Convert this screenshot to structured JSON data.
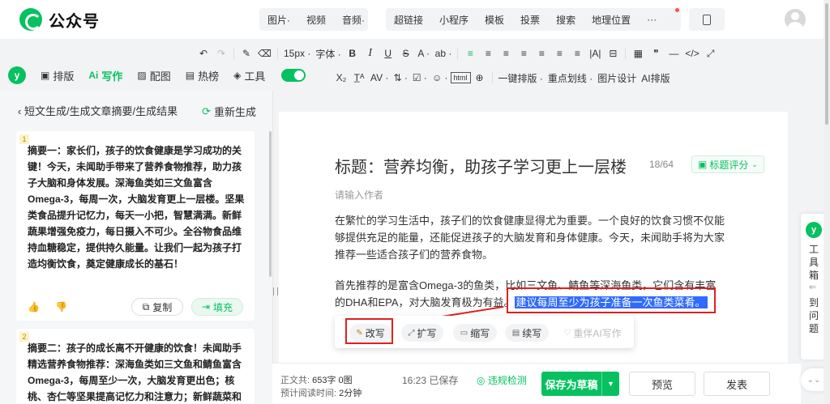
{
  "app": {
    "title": "公众号"
  },
  "insert_bar": {
    "group1": [
      "图片·",
      "视频",
      "音频·"
    ],
    "group2": [
      "超链接",
      "小程序",
      "模板",
      "投票",
      "搜索",
      "地理位置",
      "···"
    ]
  },
  "toolbar_row1": {
    "undo": "↶",
    "redo": "↷",
    "brush": "✎",
    "clear": "⌫",
    "font_size": "15px ·",
    "font_family": "字体 ·",
    "bold": "B",
    "italic": "I",
    "underline": "U",
    "strike": "S",
    "font_color": "A ·",
    "bg_color": "ab ·",
    "align_items": [
      "≡",
      "≡",
      "≡",
      "≡",
      "≡",
      "≡",
      "≡"
    ],
    "extra_items": [
      "|A|",
      "⊟",
      "▦",
      "❞",
      "—",
      "</>",
      "⤢"
    ]
  },
  "toolbar_row2": {
    "items": [
      "X₂",
      "T̲ᴬ",
      "AV ·",
      "⇅ ·",
      "☑ ·",
      "☺ ·",
      "html",
      "⊕"
    ],
    "ai_items": [
      "一键排版 ·",
      "重点划线 ·",
      "图片设计",
      "AI排版"
    ]
  },
  "tabs": {
    "logo": "y",
    "items": [
      {
        "icon": "▣",
        "label": "排版"
      },
      {
        "icon": "Ai",
        "label": "写作"
      },
      {
        "icon": "▨",
        "label": "配图"
      },
      {
        "icon": "▤",
        "label": "热榜"
      },
      {
        "icon": "◈",
        "label": "工具"
      }
    ]
  },
  "left_panel": {
    "breadcrumb": "‹ 短文生成/生成文章摘要/生成结果",
    "regenerate": "重新生成",
    "cards": [
      {
        "num": "1",
        "text": "摘要一：家长们，孩子的饮食健康是学习成功的关键！今天，未闻助手带来了营养食物推荐，助力孩子大脑和身体发展。深海鱼类如三文鱼富含Omega-3，每周一次，大脑发育更上一层楼。坚果类食品提升记忆力，每天一小把，智慧满满。新鲜蔬果增强免疫力，每日摄入不可少。全谷物食品维持血糖稳定，提供持久能量。让我们一起为孩子打造均衡饮食，奠定健康成长的基石！",
        "copy": "复制",
        "fill": "填充"
      },
      {
        "num": "2",
        "text": "摘要二：孩子的成长离不开健康的饮食！未闻助手精选营养食物推荐：深海鱼类如三文鱼和鲭鱼富含Omega-3，每周至少一次，大脑发育更出色；核桃、杏仁等坚果提高记忆力和注意力；新鲜蔬菜和水果"
      }
    ]
  },
  "editor": {
    "title": "标题：营养均衡，助孩子学习更上一层楼",
    "title_count": "18/64",
    "title_score": "标题评分",
    "author_placeholder": "请输入作者",
    "para1": "在繁忙的学习生活中，孩子们的饮食健康显得尤为重要。一个良好的饮食习惯不仅能够提供充足的能量，还能促进孩子的大脑发育和身体健康。今天，未闻助手将为大家推荐一些适合孩子们的营养食物。",
    "para2_line1": "首先推荐的是富含Omega-3的鱼类，比如三文鱼、鲭鱼等深海鱼类，它们含有丰富",
    "para2_line2": "的DHA和EPA，对大脑发育极为有益。",
    "para2_highlight": "建议每周至少为孩子准备一次鱼类菜肴。"
  },
  "ai_toolbar": {
    "rewrite": "改写",
    "expand": "扩写",
    "shorten": "缩写",
    "continue": "续写",
    "companion": "重伴AI写作"
  },
  "bottom_bar": {
    "word_count_label": "正文共:",
    "word_count_value": "653字 0图",
    "read_time_label": "预计阅读时间:",
    "read_time_value": "2分钟",
    "saved": "16:23 已保存",
    "check": "违规检测",
    "save_draft": "保存为草稿",
    "preview": "预览",
    "publish": "发表"
  },
  "right_float": {
    "logo": "y",
    "toolbox": [
      "工",
      "具",
      "箱"
    ],
    "arrow": "⇐",
    "lines": [
      "到",
      "问",
      "题"
    ]
  },
  "colors": {
    "accent": "#07c160",
    "highlight": "#2f6bff",
    "annotation": "#e02020"
  }
}
